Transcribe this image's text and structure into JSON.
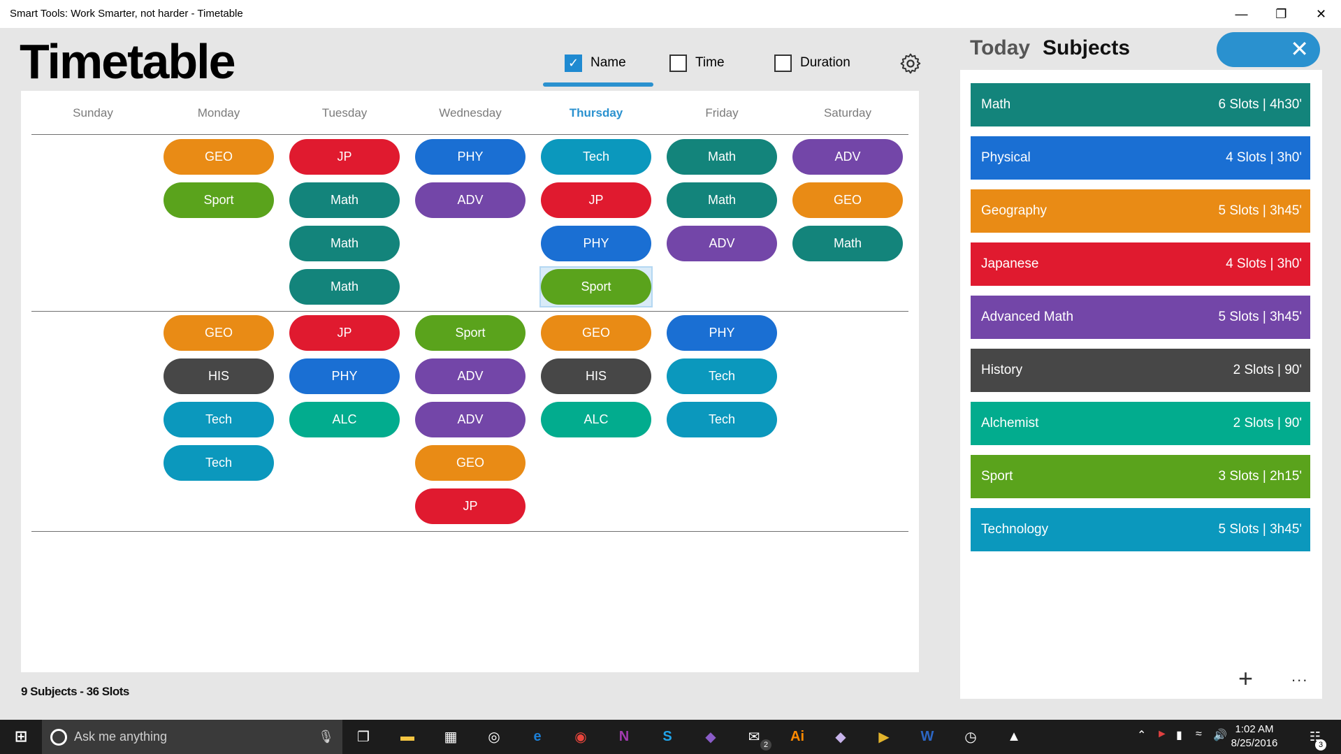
{
  "window": {
    "title": "Smart Tools: Work Smarter, not harder - Timetable",
    "minimize_icon": "minimize-icon",
    "restore_icon": "restore-icon",
    "close_icon": "close-icon"
  },
  "header": {
    "title": "Timetable",
    "toggles": [
      {
        "label": "Name",
        "checked": true
      },
      {
        "label": "Time",
        "checked": false
      },
      {
        "label": "Duration",
        "checked": false
      }
    ],
    "settings_icon": "gear-icon"
  },
  "days": [
    "Sunday",
    "Monday",
    "Tuesday",
    "Wednesday",
    "Thursday",
    "Friday",
    "Saturday"
  ],
  "active_day": "Thursday",
  "colors": {
    "GEO": "#e98b15",
    "Sport": "#5aa31c",
    "JP": "#e01a2f",
    "Math": "#13847b",
    "PHY": "#1a6fd3",
    "ADV": "#7346a8",
    "Tech": "#0b98bd",
    "HIS": "#474747",
    "ALC": "#02ac8e"
  },
  "timetable": {
    "morning": [
      [],
      [
        "GEO",
        "Sport"
      ],
      [
        "JP",
        "Math",
        "Math",
        "Math"
      ],
      [
        "PHY",
        "ADV"
      ],
      [
        "Tech",
        "JP",
        "PHY",
        "Sport"
      ],
      [
        "Math",
        "Math",
        "ADV"
      ],
      [
        "ADV",
        "GEO",
        "Math"
      ]
    ],
    "afternoon": [
      [],
      [
        "GEO",
        "HIS",
        "Tech",
        "Tech"
      ],
      [
        "JP",
        "PHY",
        "ALC"
      ],
      [
        "Sport",
        "ADV",
        "ADV",
        "GEO",
        "JP"
      ],
      [
        "GEO",
        "HIS",
        "ALC"
      ],
      [
        "PHY",
        "Tech",
        "Tech"
      ],
      []
    ]
  },
  "right_panel": {
    "tabs": [
      "Today",
      "Subjects"
    ],
    "close_icon": "close-icon",
    "subjects": [
      {
        "name": "Math",
        "info": "6 Slots | 4h30'",
        "color": "#13847b"
      },
      {
        "name": "Physical",
        "info": "4 Slots | 3h0'",
        "color": "#1a6fd3"
      },
      {
        "name": "Geography",
        "info": "5 Slots | 3h45'",
        "color": "#e98b15"
      },
      {
        "name": "Japanese",
        "info": "4 Slots | 3h0'",
        "color": "#e01a2f"
      },
      {
        "name": "Advanced Math",
        "info": "5 Slots | 3h45'",
        "color": "#7346a8"
      },
      {
        "name": "History",
        "info": "2 Slots | 90'",
        "color": "#474747"
      },
      {
        "name": "Alchemist",
        "info": "2 Slots | 90'",
        "color": "#02ac8e"
      },
      {
        "name": "Sport",
        "info": "3 Slots | 2h15'",
        "color": "#5aa31c"
      },
      {
        "name": "Technology",
        "info": "5 Slots | 3h45'",
        "color": "#0b98bd"
      }
    ],
    "add_label": "+",
    "more_label": "..."
  },
  "footer": {
    "status": "9 Subjects  -  36 Slots"
  },
  "taskbar": {
    "search_placeholder": "Ask me anything",
    "time": "1:02 AM",
    "date": "8/25/2016",
    "notification_count": "3",
    "mail_badge": "2",
    "apps": [
      {
        "name": "file-explorer-icon",
        "glyph": "▬",
        "color": "#f4c542"
      },
      {
        "name": "store-icon",
        "glyph": "▦",
        "color": "#ffffff"
      },
      {
        "name": "groove-icon",
        "glyph": "◎",
        "color": "#ffffff"
      },
      {
        "name": "edge-icon",
        "glyph": "e",
        "color": "#1c7fd6"
      },
      {
        "name": "chrome-icon",
        "glyph": "◉",
        "color": "#e8453c"
      },
      {
        "name": "onenote-icon",
        "glyph": "N",
        "color": "#a33bb0"
      },
      {
        "name": "skype-icon",
        "glyph": "S",
        "color": "#21a3e8"
      },
      {
        "name": "visual-studio-icon",
        "glyph": "◆",
        "color": "#8a5cc8"
      },
      {
        "name": "mail-icon",
        "glyph": "✉",
        "color": "#ffffff"
      },
      {
        "name": "illustrator-icon",
        "glyph": "Ai",
        "color": "#ff8a00"
      },
      {
        "name": "visual-studio-blend-icon",
        "glyph": "◆",
        "color": "#c7b3ea"
      },
      {
        "name": "video-icon",
        "glyph": "▶",
        "color": "#e2b42c"
      },
      {
        "name": "word-icon",
        "glyph": "W",
        "color": "#2c66c3"
      },
      {
        "name": "alarms-clock-icon",
        "glyph": "◷",
        "color": "#ffffff"
      },
      {
        "name": "photos-icon",
        "glyph": "▲",
        "color": "#ffffff"
      }
    ]
  }
}
